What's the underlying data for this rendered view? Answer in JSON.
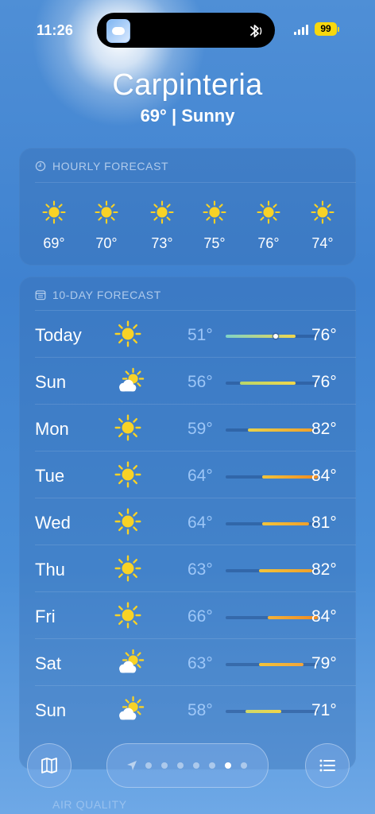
{
  "status": {
    "time": "11:26",
    "battery": "99",
    "island_icons": [
      "app-thumbnail-icon",
      "bluetooth-icon"
    ]
  },
  "location": {
    "city": "Carpinteria",
    "summary": "69°  |  Sunny"
  },
  "hourly": {
    "title": "HOURLY FORECAST",
    "items": [
      {
        "temp": "69°",
        "icon": "sun-icon"
      },
      {
        "temp": "70°",
        "icon": "sun-icon"
      },
      {
        "temp": "73°",
        "icon": "sun-icon"
      },
      {
        "temp": "75°",
        "icon": "sun-icon"
      },
      {
        "temp": "76°",
        "icon": "sun-icon"
      },
      {
        "temp": "74°",
        "icon": "sun-icon"
      }
    ]
  },
  "ten_day": {
    "title": "10-DAY FORECAST",
    "scale": {
      "min": 51,
      "max": 84
    },
    "current_temp": 69,
    "days": [
      {
        "day": "Today",
        "icon": "sun-icon",
        "low": "51°",
        "high": "76°",
        "low_val": 51,
        "high_val": 76,
        "colors": [
          "#7fd3c8",
          "#f1d64a"
        ]
      },
      {
        "day": "Sun",
        "icon": "partly-cloudy-icon",
        "low": "56°",
        "high": "76°",
        "low_val": 56,
        "high_val": 76,
        "colors": [
          "#b8d66a",
          "#f1d64a"
        ]
      },
      {
        "day": "Mon",
        "icon": "sun-icon",
        "low": "59°",
        "high": "82°",
        "low_val": 59,
        "high_val": 82,
        "colors": [
          "#e8d24a",
          "#f0a02a"
        ]
      },
      {
        "day": "Tue",
        "icon": "sun-icon",
        "low": "64°",
        "high": "84°",
        "low_val": 64,
        "high_val": 84,
        "colors": [
          "#f2c43a",
          "#f08a20"
        ]
      },
      {
        "day": "Wed",
        "icon": "sun-icon",
        "low": "64°",
        "high": "81°",
        "low_val": 64,
        "high_val": 81,
        "colors": [
          "#f2c43a",
          "#f0a02a"
        ]
      },
      {
        "day": "Thu",
        "icon": "sun-icon",
        "low": "63°",
        "high": "82°",
        "low_val": 63,
        "high_val": 82,
        "colors": [
          "#f2c43a",
          "#f0a02a"
        ]
      },
      {
        "day": "Fri",
        "icon": "sun-icon",
        "low": "66°",
        "high": "84°",
        "low_val": 66,
        "high_val": 84,
        "colors": [
          "#f2b23a",
          "#f08a20"
        ]
      },
      {
        "day": "Sat",
        "icon": "partly-cloudy-icon",
        "low": "63°",
        "high": "79°",
        "low_val": 63,
        "high_val": 79,
        "colors": [
          "#f2c43a",
          "#f2a43a"
        ]
      },
      {
        "day": "Sun",
        "icon": "partly-cloudy-icon",
        "low": "58°",
        "high": "71°",
        "low_val": 58,
        "high_val": 71,
        "colors": [
          "#cfd86a",
          "#f1d64a"
        ]
      }
    ]
  },
  "bottom": {
    "pages": 7,
    "active_page": 5,
    "peek_label": "AIR QUALITY"
  }
}
